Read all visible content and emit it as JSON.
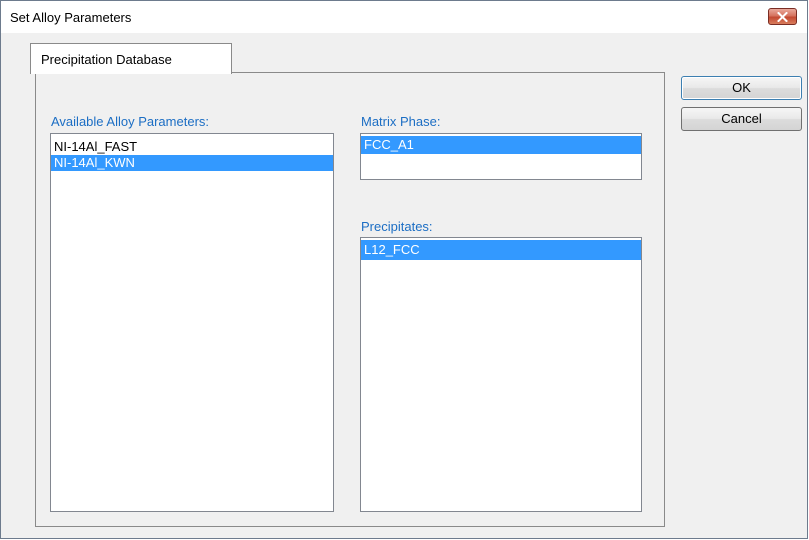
{
  "window": {
    "title": "Set Alloy Parameters"
  },
  "tabs": [
    {
      "label": "Precipitation Database",
      "active": true
    }
  ],
  "alloy_parameters": {
    "label": "Available Alloy Parameters:",
    "items": [
      {
        "text": "NI-14Al_FAST",
        "selected": false
      },
      {
        "text": "NI-14Al_KWN",
        "selected": true
      }
    ]
  },
  "matrix_phase": {
    "label": "Matrix Phase:",
    "items": [
      {
        "text": "FCC_A1",
        "selected": true
      }
    ]
  },
  "precipitates": {
    "label": "Precipitates:",
    "items": [
      {
        "text": "L12_FCC",
        "selected": true
      }
    ]
  },
  "buttons": {
    "ok": "OK",
    "cancel": "Cancel"
  },
  "colors": {
    "selection": "#3399ff",
    "label_blue": "#1c6ec4",
    "close_button": "#c34a33"
  },
  "icons": {
    "close": "close-icon"
  }
}
